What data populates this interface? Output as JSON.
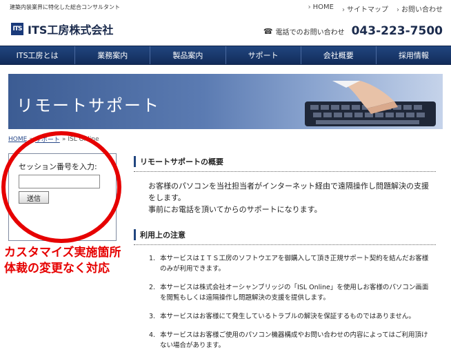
{
  "header": {
    "tagline": "建築内装業界に特化した総合コンサルタント",
    "logo_mark": "ITS",
    "logo_text": "ITS工房株式会社",
    "links": [
      "HOME",
      "サイトマップ",
      "お問い合わせ"
    ],
    "phone_label": "電話でのお問い合わせ",
    "phone_number": "043-223-7500"
  },
  "nav": [
    "ITS工房とは",
    "業務案内",
    "製品案内",
    "サポート",
    "会社概要",
    "採用情報"
  ],
  "banner": {
    "title": "リモートサポート"
  },
  "breadcrumb": [
    "HOME",
    "サポート",
    "ISL Online"
  ],
  "session": {
    "label": "セッション番号を入力:",
    "input_value": "",
    "button_label": "送信"
  },
  "callout": {
    "line1": "カスタマイズ実施箇所",
    "line2": "体裁の変更なく対応"
  },
  "main": {
    "overview_heading": "リモートサポートの概要",
    "overview_text": [
      "お客様のパソコンを当社担当者がインターネット経由で遠隔操作し問題解決の支援をします。",
      "事前にお電話を頂いてからのサポートになります。"
    ],
    "notes_heading": "利用上の注意",
    "notes": [
      {
        "num": "1.",
        "text": "本サービスはＩＴＳ工房のソフトウエアを御購入して頂き正規サポート契約を結んだお客様のみが利用できます。"
      },
      {
        "num": "2.",
        "text": "本サービスは株式会社オーシャンブリッジの「ISL Online」を使用しお客様のパソコン画面を閲覧もしくは遠隔操作し問題解決の支援を提供します。"
      },
      {
        "num": "3.",
        "text": "本サービスはお客様にて発生しているトラブルの解決を保証するものではありません。"
      },
      {
        "num": "4.",
        "text": "本サービスはお客様ご使用のパソコン機器構成やお問い合わせの内容によってはご利用頂けない場合があります。"
      }
    ]
  }
}
